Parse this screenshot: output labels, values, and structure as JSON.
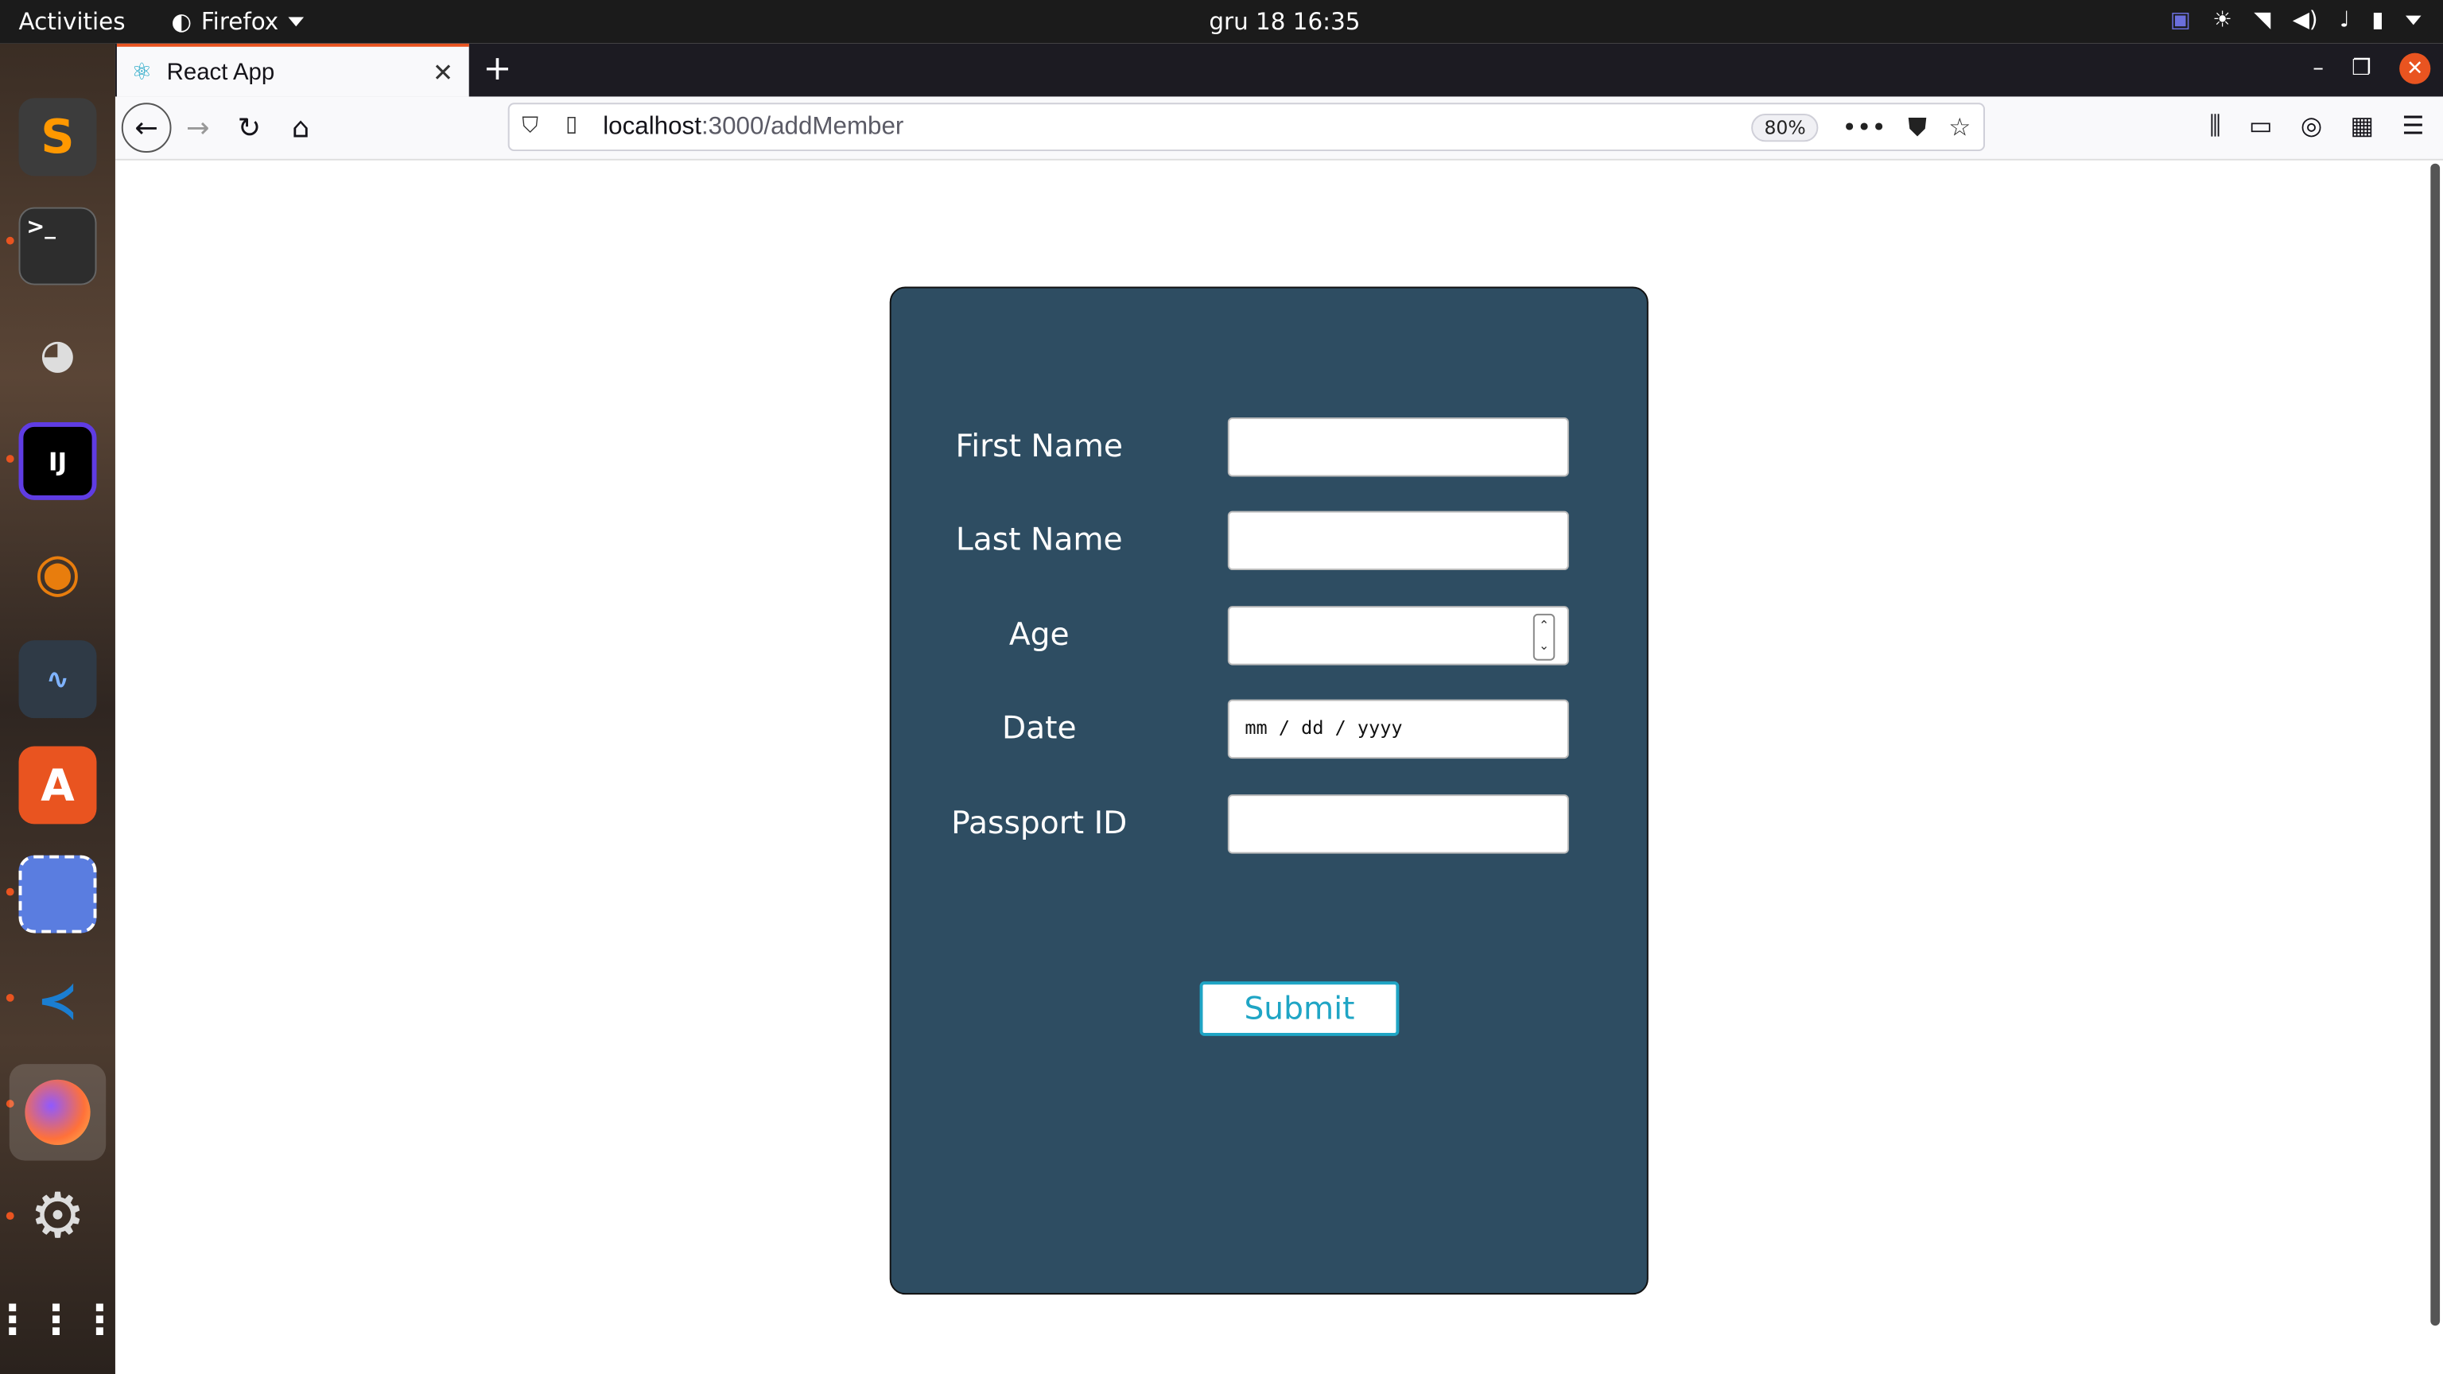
{
  "system_bar": {
    "activities": "Activities",
    "app_name": "Firefox",
    "clock": "gru 18  16:35",
    "tray_icons": [
      "teams-icon",
      "brightness-icon",
      "wifi-icon",
      "volume-icon",
      "mic-icon",
      "battery-icon",
      "chevron-down-icon"
    ]
  },
  "dock": {
    "apps": [
      {
        "name": "Sublime Text",
        "icon": "sublime-icon",
        "color": "#4a4a4a"
      },
      {
        "name": "Terminal",
        "icon": "terminal-icon",
        "color": "#3b3b3b"
      },
      {
        "name": "GIMP",
        "icon": "gimp-icon",
        "color": "#7a7a7a"
      },
      {
        "name": "IntelliJ IDEA",
        "icon": "intellij-icon",
        "color": "#000000"
      },
      {
        "name": "Blender",
        "icon": "blender-icon",
        "color": "#e87d0d"
      },
      {
        "name": "System Monitor",
        "icon": "system-monitor-icon",
        "color": "#2f3a46"
      },
      {
        "name": "Ubuntu Software",
        "icon": "software-center-icon",
        "color": "#e95420"
      },
      {
        "name": "Screenshot",
        "icon": "screenshot-icon",
        "color": "#5a7de0"
      },
      {
        "name": "Visual Studio Code",
        "icon": "vscode-icon",
        "color": "#1b7ed1"
      },
      {
        "name": "Firefox",
        "icon": "firefox-icon",
        "color": "#ff7139"
      },
      {
        "name": "Settings",
        "icon": "settings-icon",
        "color": "#6d6d6d"
      },
      {
        "name": "Show Applications",
        "icon": "app-grid-icon",
        "color": "#ffffff"
      }
    ]
  },
  "browser": {
    "tab_title": "React App",
    "url_host": "localhost",
    "url_path": ":3000/addMember",
    "zoom": "80%"
  },
  "form": {
    "fields": [
      {
        "label": "First Name",
        "value": ""
      },
      {
        "label": "Last Name",
        "value": ""
      },
      {
        "label": "Age",
        "value": ""
      },
      {
        "label": "Date",
        "value": "",
        "placeholder": "mm / dd / yyyy"
      },
      {
        "label": "Passport ID",
        "value": ""
      }
    ],
    "submit_label": "Submit"
  },
  "colors": {
    "card_bg": "#2e4d62",
    "accent": "#1fa5c5",
    "ubuntu_orange": "#e95420"
  }
}
